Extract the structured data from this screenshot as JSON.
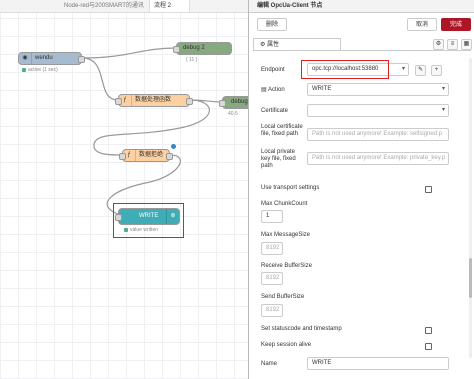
{
  "tabs": [
    "Node-red与200SMART的通讯",
    "流程 2"
  ],
  "nodes": {
    "inject": {
      "label": "wendu",
      "status": "active (1 sec)"
    },
    "debug_top": {
      "label": "debug 2",
      "count": "{ 11 }"
    },
    "func1": {
      "label": "数据处理函数"
    },
    "debug_right": {
      "label": "debug",
      "status": "40.5"
    },
    "func2": {
      "label": "数据拒绝"
    },
    "write": {
      "label": "WRITE",
      "status": "value written"
    }
  },
  "tray": {
    "title": "编辑 OpcUa-Client 节点",
    "delete_label": "删除",
    "cancel_label": "取消",
    "done_label": "完成",
    "properties_tab": "属性",
    "fields": {
      "endpoint_label": "Endpoint",
      "endpoint_value": "opc.tcp://localhost:53880",
      "action_label": "Action",
      "action_value": "WRITE",
      "certificate_label": "Certificate",
      "certificate_value": "",
      "local_cert_label": "Local certificate file, fixed path",
      "local_cert_placeholder": "Path is not used anymore! Example: selfsigned.p",
      "local_key_label": "Local private key file, fixed path",
      "local_key_placeholder": "Path is not used anymore! Example: private_key.p",
      "transport_label": "Use transport settings",
      "max_chunk_label": "Max ChunkCount",
      "max_chunk_value": "1",
      "max_msg_label": "Max MessageSize",
      "max_msg_value": "8192",
      "recv_buf_label": "Receive BufferSize",
      "recv_buf_value": "8192",
      "send_buf_label": "Send BufferSize",
      "send_buf_value": "8192",
      "statuscode_label": "Set statuscode and timestamp",
      "keep_alive_label": "Keep session alive",
      "name_label": "Name",
      "name_value": "WRITE"
    }
  },
  "colors": {
    "accent": "#ad1625",
    "highlight": "#e02020",
    "inject": "#a6bbcf",
    "debug": "#87a980",
    "function": "#fdd0a2",
    "opcua": "#3fadb5"
  }
}
